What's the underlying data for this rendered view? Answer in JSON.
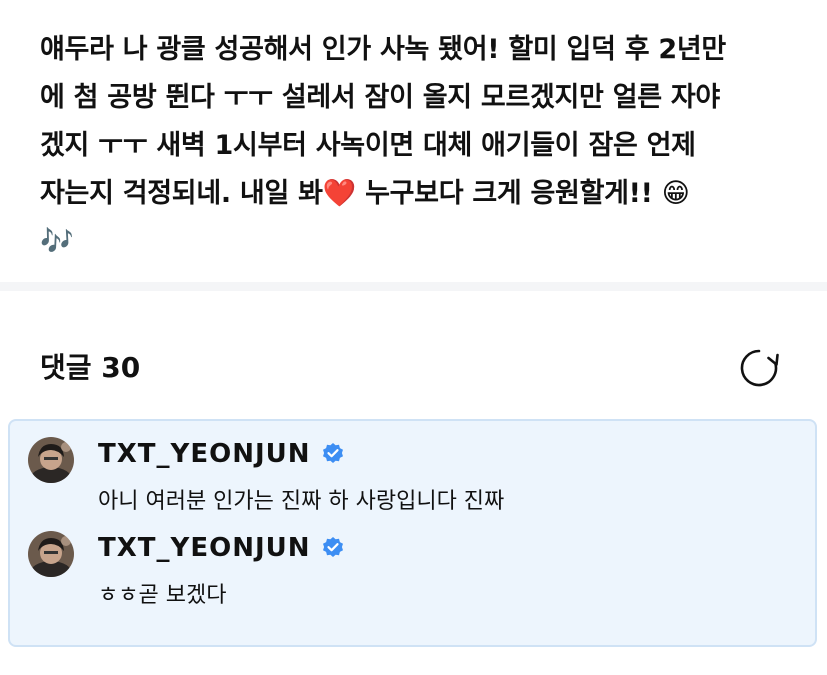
{
  "post": {
    "body": "얘두라 나 광클 성공해서 인가 사녹 됐어! 할미 입덕 후 2년만\n에 첨 공방 뛴다 ㅜㅜ 설레서 잠이 올지 모르겠지만 얼른 자야\n겠지 ㅜㅜ 새벽 1시부터 사녹이면 대체 애기들이 잠은 언제\n자는지 걱정되네. 내일 봐❤️ 누구보다 크게 응원할게!! 😁\n🎶"
  },
  "comments_section": {
    "title": "댓글 30",
    "refresh_icon": "refresh-icon"
  },
  "comments": [
    {
      "author": "TXT_YEONJUN",
      "verified": true,
      "text": "아니 여러분 인가는 진짜 하 사랑입니다 진짜"
    },
    {
      "author": "TXT_YEONJUN",
      "verified": true,
      "text": "ㅎㅎ곧 보겠다"
    }
  ],
  "colors": {
    "comment_bg": "#edf5fd",
    "comment_border": "#cfe2f5",
    "verified": "#3d8ef3",
    "divider": "#f4f5f7"
  }
}
